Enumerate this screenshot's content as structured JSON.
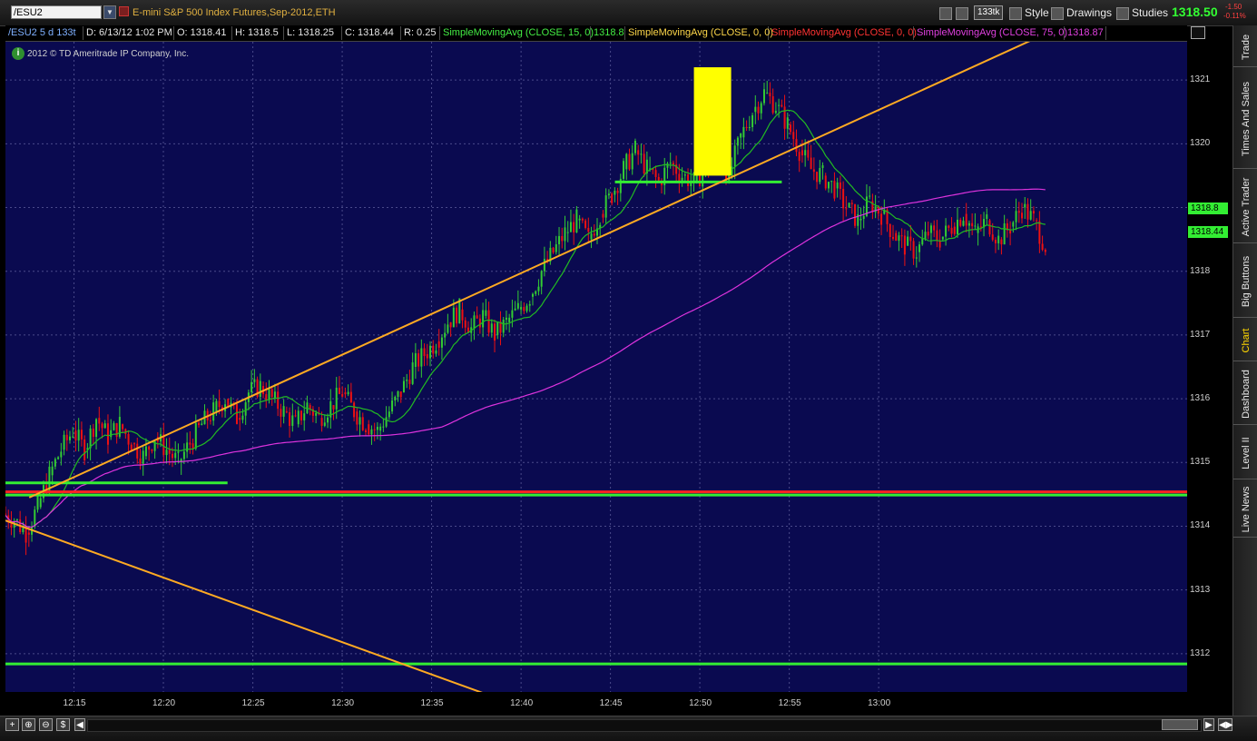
{
  "toolbar": {
    "symbol": "/ESU2",
    "description": "E-mini S&P 500 Index Futures,Sep-2012,ETH",
    "aggregation": "133tk",
    "style_label": "Style",
    "drawings_label": "Drawings",
    "studies_label": "Studies",
    "last_price": "1318.50",
    "net_change": "-1.50",
    "pct_change": "-0.11%"
  },
  "info_row": {
    "period": "/ESU2 5 d 133t",
    "date": "D: 6/13/12 1:02 PM",
    "open": "O: 1318.41",
    "high": "H: 1318.5",
    "low": "L: 1318.25",
    "close": "C: 1318.44",
    "range": "R: 0.25",
    "study1": "SimpleMovingAvg (CLOSE, 15, 0)",
    "study1_value": "1318.8",
    "study2": "SimpleMovingAvg (CLOSE, 0, 0)",
    "study3": "SimpleMovingAvg (CLOSE, 0, 0)",
    "study4": "SimpleMovingAvg (CLOSE, 75, 0)",
    "study4_value": "1318.87"
  },
  "copyright": "2012 © TD Ameritrade IP Company, Inc.",
  "price_tags": {
    "sma15": "1318.8",
    "last": "1318.44"
  },
  "right_tabs": [
    "Trade",
    "Times And Sales",
    "Active Trader",
    "Big Buttons",
    "Chart",
    "Dashboard",
    "Level II",
    "Live News"
  ],
  "colors": {
    "background": "#0a0a50",
    "grid": "#4a4a8a",
    "up_candle": "#33cc33",
    "down_candle": "#ee1111",
    "sma15": "#22bb22",
    "sma75": "#dd33dd",
    "trendline": "#ffaa22",
    "level_green": "#33ee33",
    "level_red": "#ff2222",
    "highlight": "#ffff00"
  },
  "chart_data": {
    "type": "candlestick",
    "y_ticks": [
      1312,
      1313,
      1314,
      1315,
      1316,
      1317,
      1318,
      1319,
      1320,
      1321
    ],
    "ylim": [
      1311.4,
      1321.6
    ],
    "x_ticks": [
      "12:15",
      "12:20",
      "12:25",
      "12:30",
      "12:35",
      "12:40",
      "12:45",
      "12:50",
      "12:55",
      "13:00"
    ],
    "x_tick_times": [
      12.25,
      12.3333,
      12.4167,
      12.5,
      12.5833,
      12.6667,
      12.75,
      12.8333,
      12.9167,
      13.0
    ],
    "xlim": [
      12.1861,
      13.2875
    ],
    "closes": [
      1314.1,
      1313.9,
      1314.3,
      1314.8,
      1315.2,
      1315.5,
      1315.2,
      1315.7,
      1315.4,
      1315.6,
      1315.3,
      1315.1,
      1315.4,
      1315.2,
      1315.0,
      1315.3,
      1315.6,
      1315.8,
      1316.0,
      1315.7,
      1316.1,
      1316.2,
      1316.0,
      1315.8,
      1315.6,
      1315.9,
      1315.7,
      1315.9,
      1316.1,
      1315.8,
      1315.6,
      1315.5,
      1315.8,
      1316.1,
      1316.5,
      1316.7,
      1316.9,
      1317.2,
      1317.4,
      1317.1,
      1317.3,
      1317.0,
      1317.2,
      1317.4,
      1317.6,
      1318.0,
      1318.3,
      1318.6,
      1318.8,
      1318.5,
      1318.9,
      1319.2,
      1319.6,
      1319.9,
      1319.6,
      1319.4,
      1319.7,
      1319.5,
      1319.4,
      1319.6,
      1319.8,
      1319.5,
      1320.1,
      1320.5,
      1320.8,
      1320.6,
      1320.3,
      1319.9,
      1319.6,
      1319.5,
      1319.3,
      1319.0,
      1318.8,
      1319.1,
      1318.9,
      1318.6,
      1318.4,
      1318.3,
      1318.6,
      1318.5,
      1318.7,
      1318.9,
      1318.6,
      1318.8,
      1318.5,
      1318.7,
      1319.0,
      1318.8,
      1318.4
    ],
    "sma_periods": [
      15,
      75
    ],
    "levels": [
      {
        "type": "support",
        "value": 1314.68,
        "x_from": 12.1861,
        "x_to": 12.3931
      },
      {
        "type": "line",
        "value": 1314.54,
        "color": "red"
      },
      {
        "type": "line",
        "value": 1314.49,
        "color": "green"
      },
      {
        "type": "line",
        "value": 1311.84,
        "color": "green"
      },
      {
        "type": "support",
        "value": 1319.4,
        "x_from": 12.7542,
        "x_to": 12.9097
      }
    ],
    "trendlines": [
      {
        "from": [
          12.2083,
          1314.45
        ],
        "to": [
          13.1653,
          1321.8
        ]
      },
      {
        "from": [
          12.1861,
          1314.09
        ],
        "to": [
          12.6778,
          1311.1
        ]
      }
    ],
    "highlight": {
      "x_from": 12.8278,
      "x_to": 12.8625,
      "y_from": 1319.5,
      "y_to": 1321.2
    }
  }
}
